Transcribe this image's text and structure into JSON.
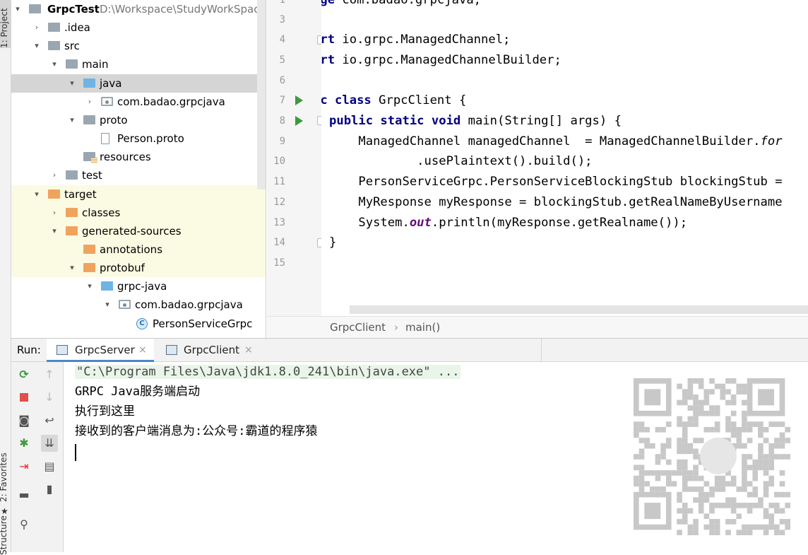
{
  "side_tabs": {
    "project": "1: Project",
    "favorites": "2: Favorites",
    "structure": "Structure"
  },
  "tree": {
    "items": [
      {
        "label": "GrpcTest",
        "path": "D:\\Workspace\\StudyWorkSpace\\",
        "arrow": "▾",
        "icon": "folder-icon"
      },
      {
        "label": ".idea",
        "arrow": "›",
        "icon": "folder-icon"
      },
      {
        "label": "src",
        "arrow": "▾",
        "icon": "folder-icon"
      },
      {
        "label": "main",
        "arrow": "▾",
        "icon": "folder-icon"
      },
      {
        "label": "java",
        "arrow": "▾",
        "icon": "source-folder-icon"
      },
      {
        "label": "com.badao.grpcjava",
        "arrow": "›",
        "icon": "package-icon"
      },
      {
        "label": "proto",
        "arrow": "▾",
        "icon": "folder-icon"
      },
      {
        "label": "Person.proto",
        "arrow": "",
        "icon": "file-icon"
      },
      {
        "label": "resources",
        "arrow": "",
        "icon": "resources-folder-icon"
      },
      {
        "label": "test",
        "arrow": "›",
        "icon": "folder-icon"
      },
      {
        "label": "target",
        "arrow": "▾",
        "icon": "excluded-folder-icon"
      },
      {
        "label": "classes",
        "arrow": "›",
        "icon": "excluded-folder-icon"
      },
      {
        "label": "generated-sources",
        "arrow": "▾",
        "icon": "excluded-folder-icon"
      },
      {
        "label": "annotations",
        "arrow": "",
        "icon": "excluded-folder-icon"
      },
      {
        "label": "protobuf",
        "arrow": "▾",
        "icon": "excluded-folder-icon"
      },
      {
        "label": "grpc-java",
        "arrow": "▾",
        "icon": "generated-source-folder-icon"
      },
      {
        "label": "com.badao.grpcjava",
        "arrow": "▾",
        "icon": "package-icon"
      },
      {
        "label": "PersonServiceGrpc",
        "arrow": "",
        "icon": "class-icon"
      }
    ]
  },
  "editor": {
    "line_numbers": [
      "1",
      "3",
      "4",
      "5",
      "6",
      "7",
      "8",
      "9",
      "10",
      "11",
      "12",
      "13",
      "14",
      "15"
    ],
    "code": {
      "l1a": "age ",
      "l1b": "com.badao.grpcjava;",
      "l3a": "ort ",
      "l3b": "io.grpc.ManagedChannel;",
      "l4a": "ort ",
      "l4b": "io.grpc.ManagedChannelBuilder;",
      "l6a": "ic class ",
      "l6b": "GrpcClient {",
      "l7a": "public static void ",
      "l7b": "main(String[] args) {",
      "l8a": "    ManagedChannel managedChannel  = ManagedChannelBuilder.",
      "l8b": "for",
      "l9": "            .usePlaintext().build();",
      "l10": "    PersonServiceGrpc.PersonServiceBlockingStub blockingStub = ",
      "l11": "    MyResponse myResponse = blockingStub.getRealNameByUsername",
      "l12a": "    System.",
      "l12b": "out",
      "l12c": ".println(myResponse.getRealname());",
      "l13": "}"
    },
    "breadcrumb": [
      "GrpcClient",
      "main()"
    ],
    "breadcrumb_sep": "›"
  },
  "run": {
    "label": "Run:",
    "tabs": [
      {
        "label": "GrpcServer",
        "close": "×"
      },
      {
        "label": "GrpcClient",
        "close": "×"
      }
    ],
    "console_lines": [
      "\"C:\\Program Files\\Java\\jdk1.8.0_241\\bin\\java.exe\" ...",
      "GRPC Java服务端启动",
      "执行到这里",
      "接收到的客户端消息为:公众号:霸道的程序猿"
    ]
  },
  "colors": {
    "accent": "#4a88c7",
    "keyword": "#000080",
    "static_field": "#660e7a",
    "run_green": "#3c9a3c",
    "stop_red": "#e04e4e"
  }
}
